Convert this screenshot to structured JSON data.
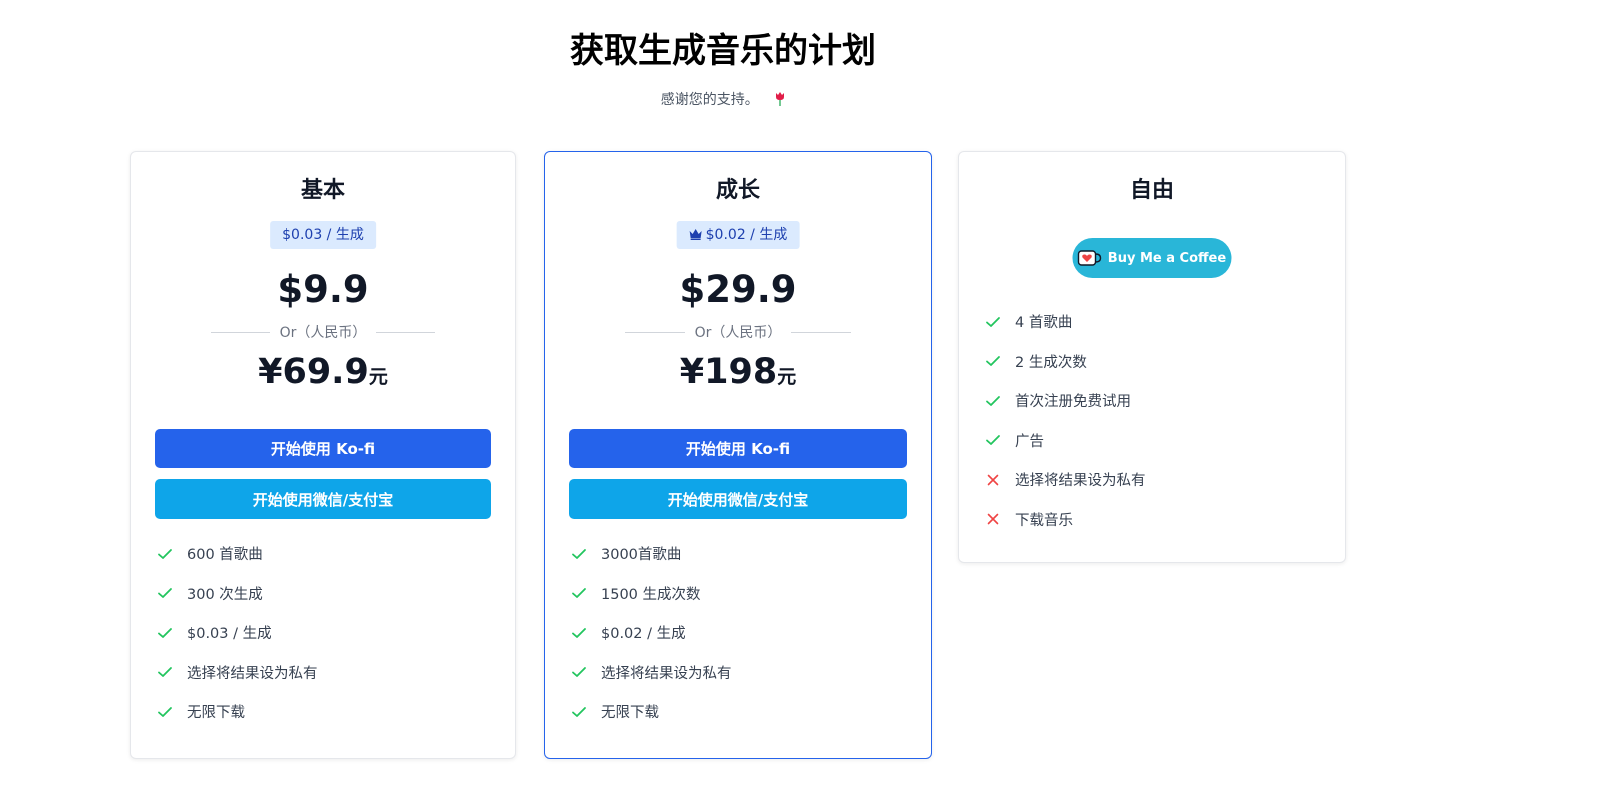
{
  "header": {
    "title": "获取生成音乐的计划",
    "subtitle": "感谢您的支持。"
  },
  "colors": {
    "primary": "#2563eb",
    "secondary": "#0ea5e9",
    "check": "#22c55e",
    "cross": "#ef4444",
    "badge_bg": "#dbeafe",
    "coffee": "#29b6d8"
  },
  "plans": [
    {
      "name": "基本",
      "rate": "$0.03 / 生成",
      "price_usd": "$9.9",
      "or_text": "Or（人民币）",
      "price_cny": "¥69.9",
      "price_cny_unit": "元",
      "kofi_button": "开始使用 Ko-fi",
      "wechat_button": "开始使用微信/支付宝",
      "features": [
        {
          "text": "600 首歌曲",
          "included": true
        },
        {
          "text": "300 次生成",
          "included": true
        },
        {
          "text": "$0.03 / 生成",
          "included": true
        },
        {
          "text": "选择将结果设为私有",
          "included": true
        },
        {
          "text": "无限下载",
          "included": true
        }
      ]
    },
    {
      "name": "成长",
      "rate": "$0.02 / 生成",
      "rate_icon": "crown-icon",
      "price_usd": "$29.9",
      "or_text": "Or（人民币）",
      "price_cny": "¥198",
      "price_cny_unit": "元",
      "kofi_button": "开始使用 Ko-fi",
      "wechat_button": "开始使用微信/支付宝",
      "features": [
        {
          "text": "3000首歌曲",
          "included": true
        },
        {
          "text": "1500 生成次数",
          "included": true
        },
        {
          "text": "$0.02 / 生成",
          "included": true
        },
        {
          "text": "选择将结果设为私有",
          "included": true
        },
        {
          "text": "无限下载",
          "included": true
        }
      ]
    },
    {
      "name": "自由",
      "coffee_button": "Buy Me a Coffee",
      "features": [
        {
          "text": "4 首歌曲",
          "included": true
        },
        {
          "text": "2 生成次数",
          "included": true
        },
        {
          "text": "首次注册免费试用",
          "included": true
        },
        {
          "text": "广告",
          "included": true
        },
        {
          "text": "选择将结果设为私有",
          "included": false
        },
        {
          "text": "下载音乐",
          "included": false
        }
      ]
    }
  ]
}
